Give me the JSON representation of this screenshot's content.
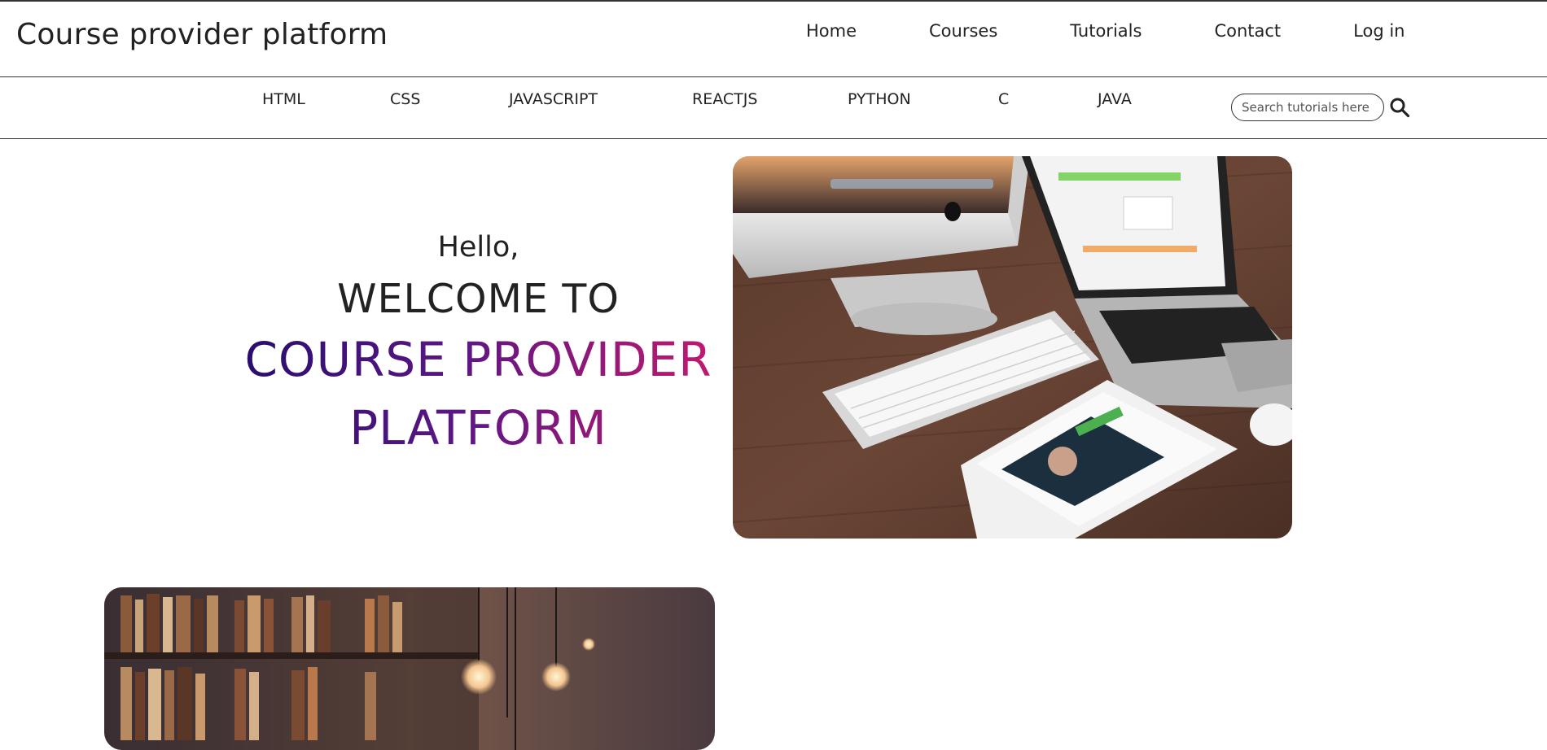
{
  "header": {
    "brand": "Course provider platform",
    "nav": [
      {
        "label": "Home"
      },
      {
        "label": "Courses"
      },
      {
        "label": "Tutorials"
      },
      {
        "label": "Contact"
      },
      {
        "label": "Log in"
      }
    ]
  },
  "subnav": {
    "items": [
      {
        "label": "HTML"
      },
      {
        "label": "CSS"
      },
      {
        "label": "JAVASCRIPT"
      },
      {
        "label": "REACTJS"
      },
      {
        "label": "PYTHON"
      },
      {
        "label": "C"
      },
      {
        "label": "JAVA"
      }
    ],
    "search": {
      "placeholder": "Search tutorials here",
      "value": "",
      "icon": "search-icon"
    }
  },
  "hero": {
    "hello": "Hello,",
    "welcome": "WELCOME TO",
    "line1": "COURSE PROVIDER",
    "line2": "PLATFORM",
    "gradient_colors": [
      "#2a0d6e",
      "#5a1784",
      "#c2186f"
    ]
  },
  "colors": {
    "text": "#222222",
    "border": "#333333",
    "background": "#ffffff"
  }
}
